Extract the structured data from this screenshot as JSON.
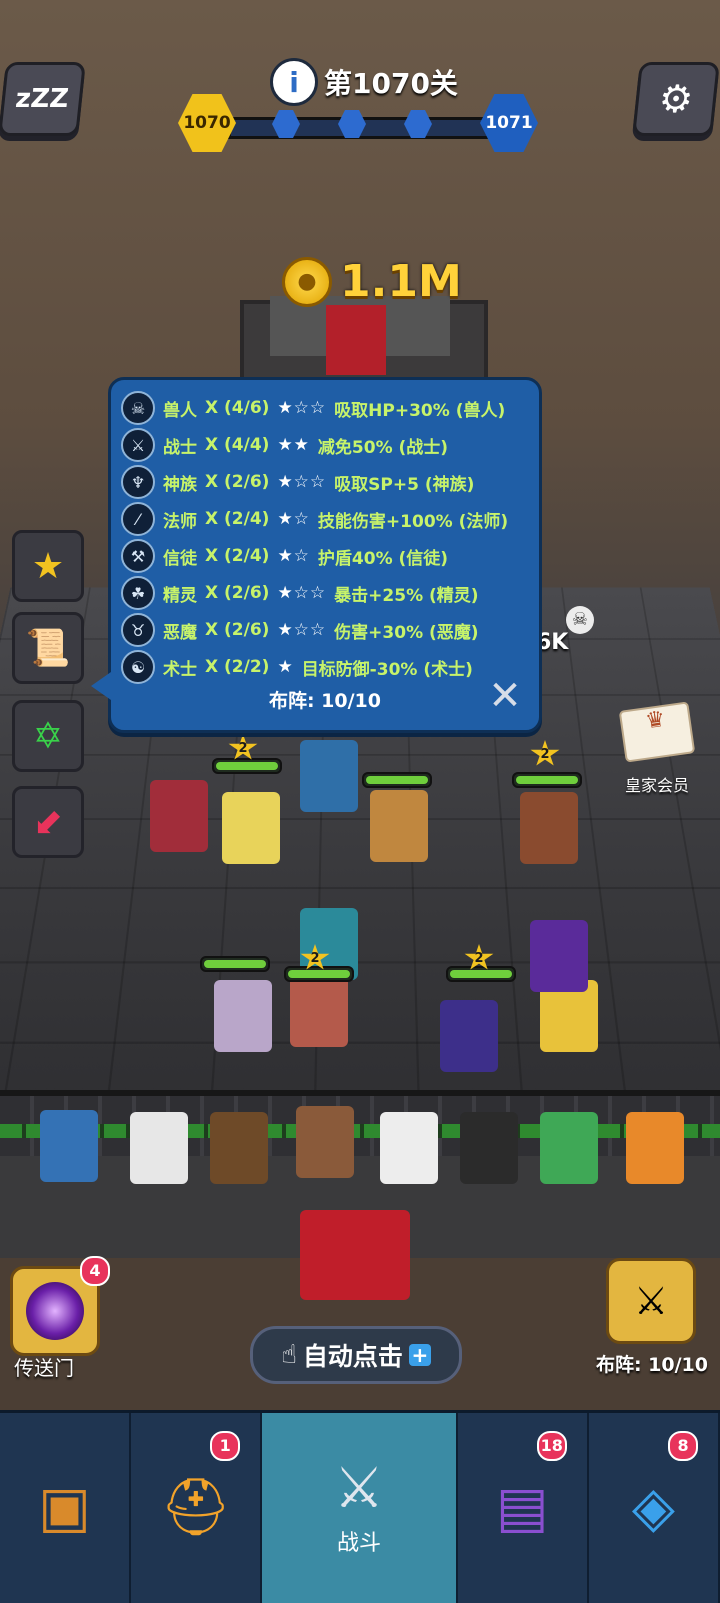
{
  "header": {
    "level_title": "第1070关",
    "current_level": "1070",
    "next_level": "1071"
  },
  "coins": "1.1M",
  "synergy_panel": {
    "rows": [
      {
        "icon": "orc-icon",
        "name": "兽人",
        "count": "X (4/6)",
        "stars": "★☆☆",
        "effect": "吸取HP+30% (兽人)"
      },
      {
        "icon": "sword-icon",
        "name": "战士",
        "count": "X (4/4)",
        "stars": "★★",
        "effect": "减免50% (战士)"
      },
      {
        "icon": "wings-icon",
        "name": "神族",
        "count": "X (2/6)",
        "stars": "★☆☆",
        "effect": "吸取SP+5 (神族)"
      },
      {
        "icon": "wand-icon",
        "name": "法师",
        "count": "X (2/4)",
        "stars": "★☆",
        "effect": "技能伤害+100% (法师)"
      },
      {
        "icon": "hammer-icon",
        "name": "信徒",
        "count": "X (2/4)",
        "stars": "★☆",
        "effect": "护盾40% (信徒)"
      },
      {
        "icon": "elf-icon",
        "name": "精灵",
        "count": "X (2/6)",
        "stars": "★☆☆",
        "effect": "暴击+25% (精灵)"
      },
      {
        "icon": "demon-icon",
        "name": "恶魔",
        "count": "X (2/6)",
        "stars": "★☆☆",
        "effect": "伤害+30% (恶魔)"
      },
      {
        "icon": "warlock-icon",
        "name": "术士",
        "count": "X (2/2)",
        "stars": "★",
        "effect": "目标防御-30% (术士)"
      }
    ],
    "formation": "布阵: 10/10"
  },
  "battle": {
    "damage_text": "6K",
    "star_level": "2",
    "royal_member": "皇家会员"
  },
  "controls": {
    "portal_label": "传送门",
    "portal_badge": "4",
    "auto_click": "自动点击",
    "formation_label": "布阵: 10/10"
  },
  "nav": [
    {
      "name": "chest",
      "icon": "treasure-chest-icon",
      "label": "",
      "badge": ""
    },
    {
      "name": "heroes",
      "icon": "winged-helmet-icon",
      "label": "",
      "badge": "1"
    },
    {
      "name": "battle",
      "icon": "crossed-swords-icon",
      "label": "战斗",
      "badge": ""
    },
    {
      "name": "book",
      "icon": "spell-book-icon",
      "label": "",
      "badge": "18"
    },
    {
      "name": "amulet",
      "icon": "amulet-icon",
      "label": "",
      "badge": "8"
    }
  ]
}
